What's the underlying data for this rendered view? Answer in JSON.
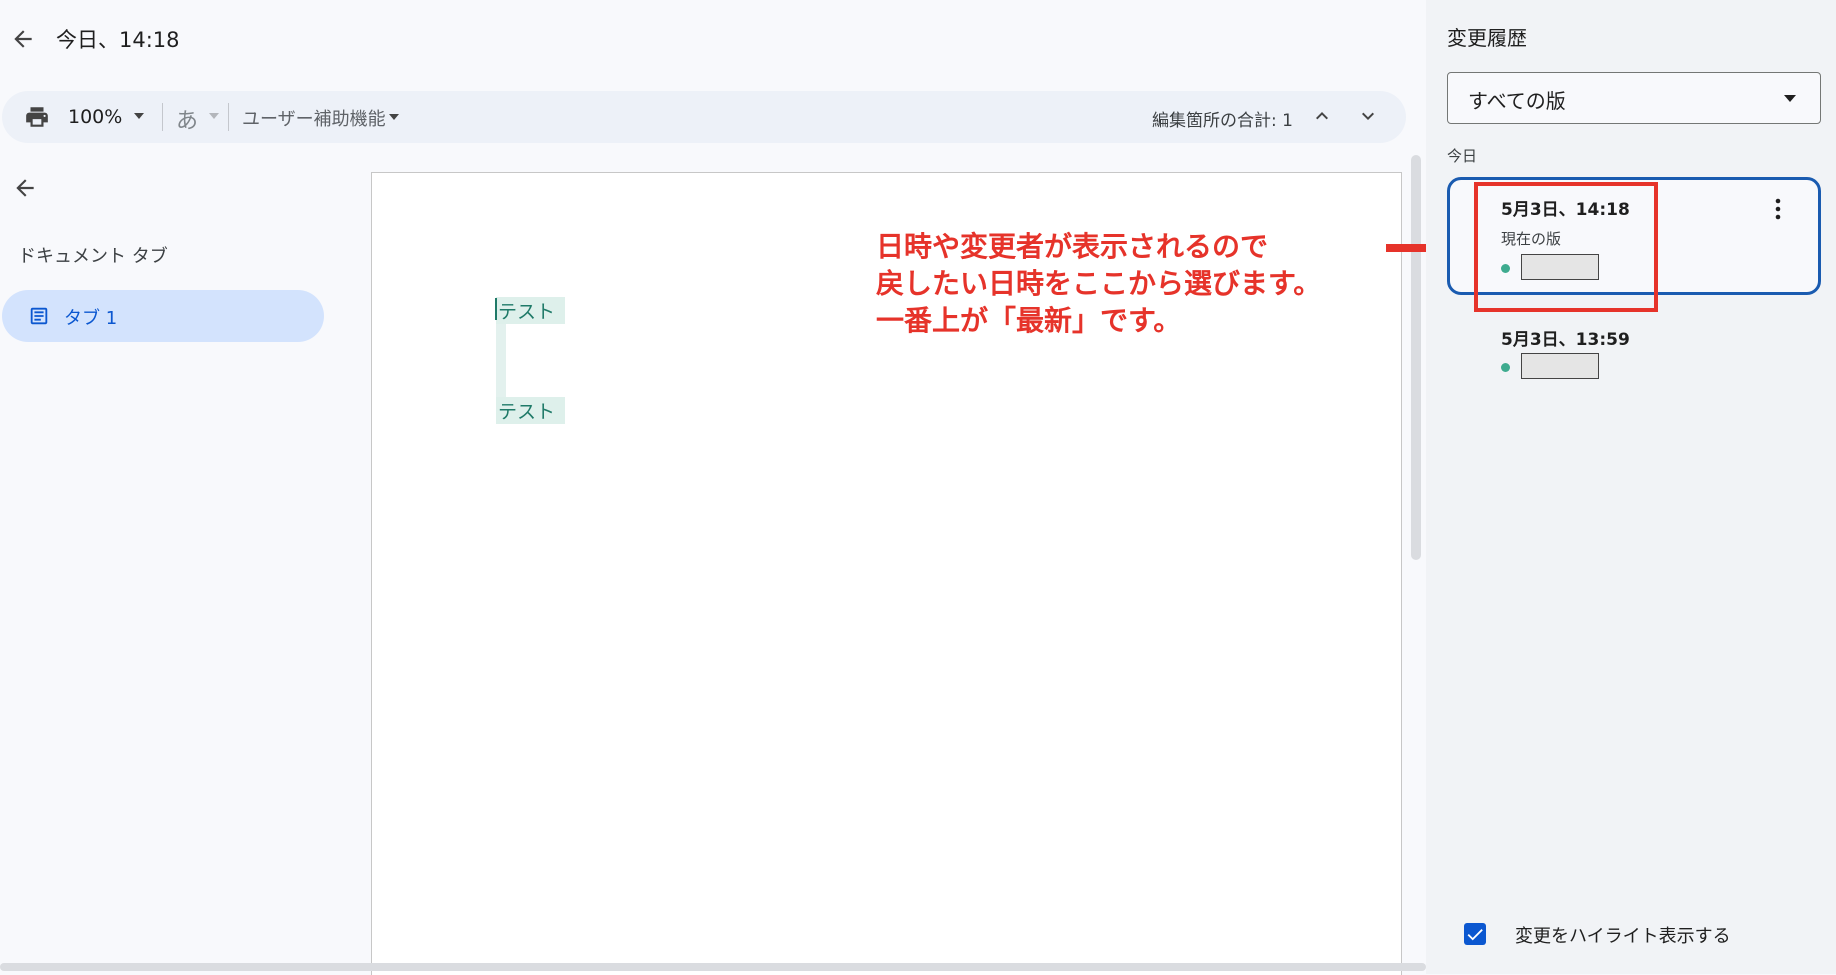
{
  "header": {
    "title": "今日、14:18"
  },
  "toolbar": {
    "zoom": "100%",
    "input_tool": "あ",
    "accessibility": "ユーザー補助機能",
    "edit_count": "編集箇所の合計: 1"
  },
  "tabs_panel": {
    "title": "ドキュメント タブ",
    "tabs": [
      {
        "label": "タブ 1"
      }
    ]
  },
  "document": {
    "lines": [
      "テスト",
      "テスト"
    ]
  },
  "annotation": {
    "text": "日時や変更者が表示されるので\n戻したい日時をここから選びます。\n一番上が「最新」です。",
    "color": "#e6332a"
  },
  "history_panel": {
    "title": "変更履歴",
    "filter": "すべての版",
    "section": "今日",
    "versions": [
      {
        "time": "5月3日、14:18",
        "label": "現在の版",
        "selected": true
      },
      {
        "time": "5月3日、13:59",
        "selected": false
      }
    ],
    "highlight_changes": {
      "label": "変更をハイライト表示する",
      "checked": true
    }
  },
  "colors": {
    "accent": "#0b57d0",
    "selected_border": "#1a5bb0",
    "editor_dot": "#3eab8f",
    "change_highlight": "#def0eb"
  },
  "icons": [
    "back-arrow-icon",
    "print-icon",
    "chevron-up-icon",
    "chevron-down-icon",
    "document-tab-icon",
    "more-vert-icon",
    "checkbox-checked-icon"
  ]
}
